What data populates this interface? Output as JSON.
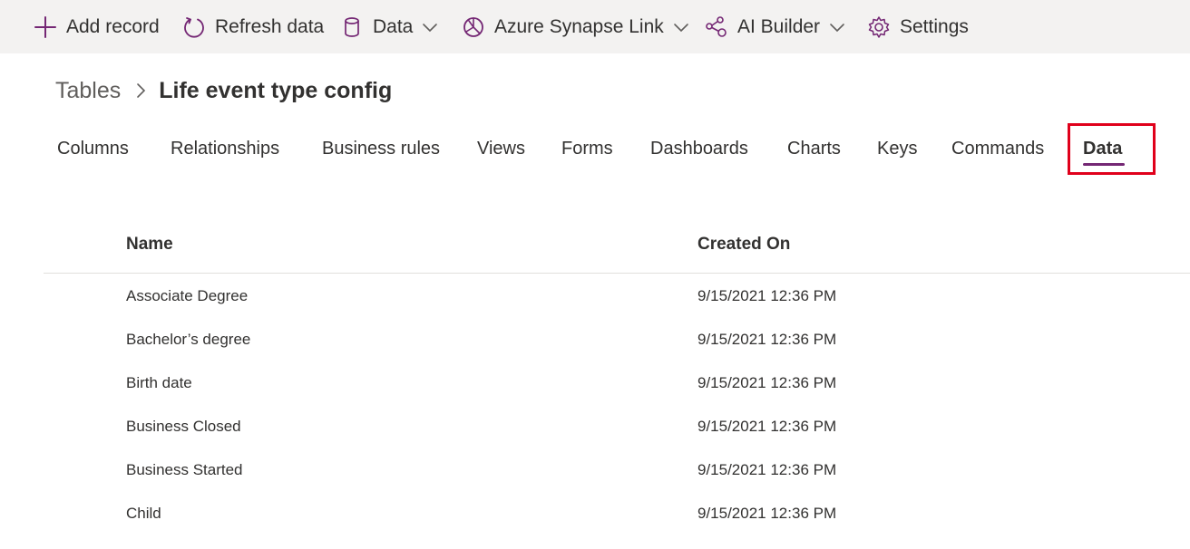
{
  "command_bar": {
    "items": [
      {
        "label": "Add record",
        "icon": "plus-icon"
      },
      {
        "label": "Refresh data",
        "icon": "refresh-icon"
      },
      {
        "label": "Data",
        "icon": "database-icon",
        "has_dropdown": true
      },
      {
        "label": "Azure Synapse Link",
        "icon": "synapse-link-icon",
        "has_dropdown": true
      },
      {
        "label": "AI Builder",
        "icon": "ai-builder-icon",
        "has_dropdown": true
      },
      {
        "label": "Settings",
        "icon": "gear-icon"
      }
    ]
  },
  "breadcrumb": {
    "root": "Tables",
    "separator_icon": "chevron-right-icon",
    "current": "Life event type config"
  },
  "tabs": [
    {
      "label": "Columns"
    },
    {
      "label": "Relationships"
    },
    {
      "label": "Business rules"
    },
    {
      "label": "Views"
    },
    {
      "label": "Forms"
    },
    {
      "label": "Dashboards"
    },
    {
      "label": "Charts"
    },
    {
      "label": "Keys"
    },
    {
      "label": "Commands"
    },
    {
      "label": "Data",
      "active": true
    }
  ],
  "table": {
    "columns": [
      "Name",
      "Created On"
    ],
    "rows": [
      {
        "name": "Associate Degree",
        "created_on": "9/15/2021 12:36 PM"
      },
      {
        "name": "Bachelor’s degree",
        "created_on": "9/15/2021 12:36 PM"
      },
      {
        "name": "Birth date",
        "created_on": "9/15/2021 12:36 PM"
      },
      {
        "name": "Business Closed",
        "created_on": "9/15/2021 12:36 PM"
      },
      {
        "name": "Business Started",
        "created_on": "9/15/2021 12:36 PM"
      },
      {
        "name": "Child",
        "created_on": "9/15/2021 12:36 PM"
      }
    ]
  },
  "colors": {
    "command_bar_bg": "#f3f2f1",
    "accent_icon": "#742774",
    "active_tab_underline": "#742774",
    "highlight_box": "#e0001b",
    "text": "#323130"
  }
}
